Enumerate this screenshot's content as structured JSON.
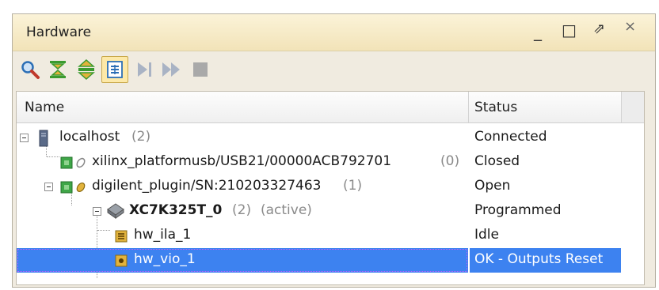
{
  "panel": {
    "title": "Hardware",
    "controls": {
      "minimize": "_",
      "maximize": "□",
      "restore": "⇗",
      "close": "×"
    }
  },
  "toolbar": {
    "buttons": [
      {
        "icon": "search-icon"
      },
      {
        "icon": "collapse-all-icon"
      },
      {
        "icon": "expand-all-icon"
      },
      {
        "icon": "auto-connect-icon",
        "pressed": true
      },
      {
        "icon": "run-trigger-icon"
      },
      {
        "icon": "run-trigger-immediate-icon"
      },
      {
        "icon": "stop-trigger-icon"
      }
    ]
  },
  "tree": {
    "columns": {
      "name": "Name",
      "status": "Status"
    },
    "rows": [
      {
        "name": "localhost",
        "count": "(2)",
        "status": "Connected"
      },
      {
        "name": "xilinx_platformusb/USB21/00000ACB792701",
        "count": "(0)",
        "status": "Closed"
      },
      {
        "name": "digilent_plugin/SN:210203327463",
        "count": "(1)",
        "status": "Open"
      },
      {
        "name": "XC7K325T_0",
        "count": "(2)",
        "extra": "(active)",
        "status": "Programmed"
      },
      {
        "name": "hw_ila_1",
        "status": "Idle"
      },
      {
        "name": "hw_vio_1",
        "status": "OK - Outputs Reset",
        "selected": true
      }
    ]
  },
  "colors": {
    "selection": "#3d82f0",
    "title_bar": "#f2e3b8",
    "panel_bg": "#f0ebe0"
  }
}
